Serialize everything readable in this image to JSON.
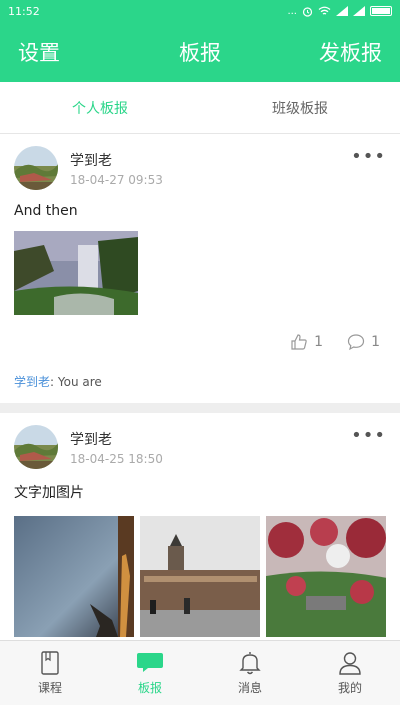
{
  "status_bar": {
    "time": "11:52",
    "signal_text": "...",
    "battery_icon": "battery-icon"
  },
  "header": {
    "left_button": "设置",
    "title": "板报",
    "right_button": "发板报",
    "color": "#2bd68a"
  },
  "tabs": [
    {
      "label": "个人板报",
      "active": true
    },
    {
      "label": "班级板报",
      "active": false
    }
  ],
  "posts": [
    {
      "author": "学到老",
      "time": "18-04-27 09:53",
      "text": "And then",
      "likes": "1",
      "comments": "1",
      "comment": {
        "author": "学到老",
        "separator": ": ",
        "text": "You are"
      }
    },
    {
      "author": "学到老",
      "time": "18-04-25 18:50",
      "text": "文字加图片"
    }
  ],
  "bottom_nav": [
    {
      "label": "课程",
      "icon": "book-icon"
    },
    {
      "label": "板报",
      "icon": "chat-bubble-icon",
      "active": true
    },
    {
      "label": "消息",
      "icon": "bell-icon"
    },
    {
      "label": "我的",
      "icon": "person-icon"
    }
  ],
  "colors": {
    "accent": "#2bd68a",
    "link": "#4a90d9",
    "text_muted": "#aaaaaa"
  }
}
